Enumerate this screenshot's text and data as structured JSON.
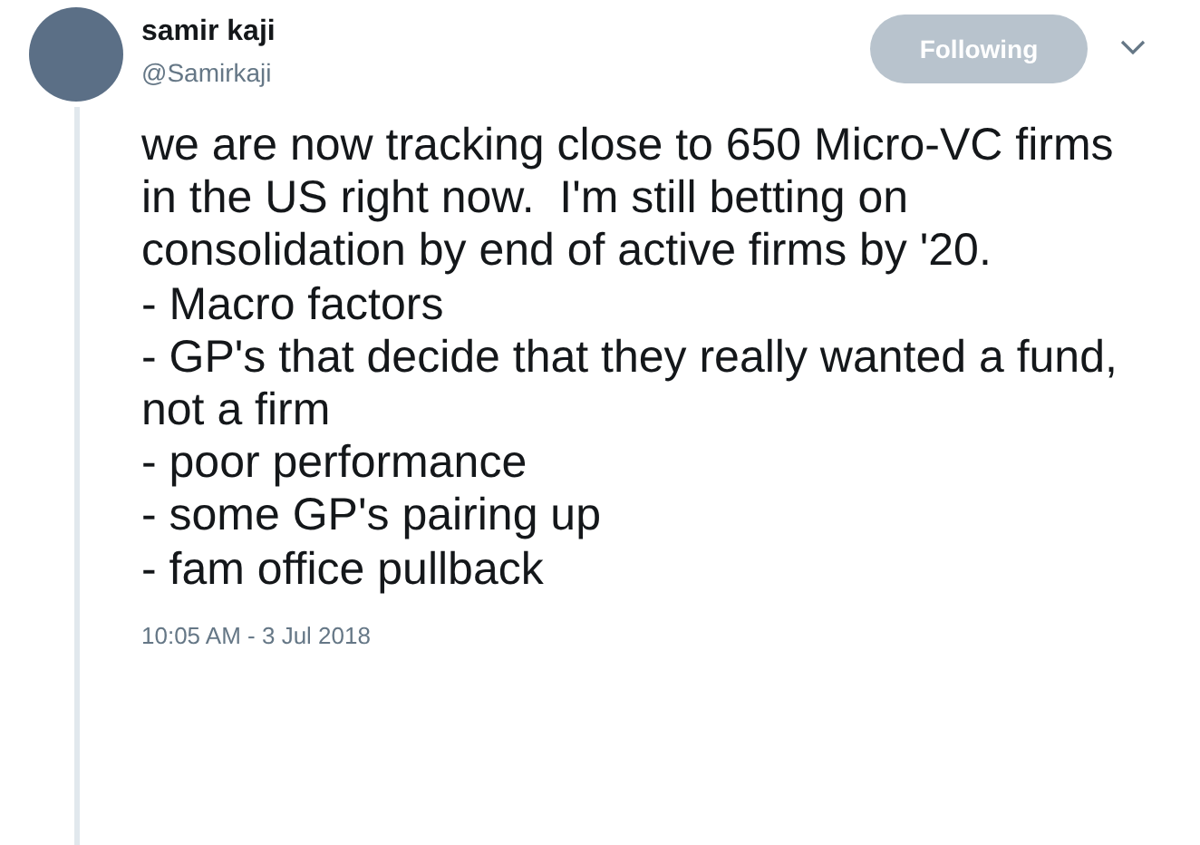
{
  "author": {
    "name": "samir kaji",
    "handle": "@Samirkaji"
  },
  "follow_button": {
    "label": "Following"
  },
  "tweet": {
    "text": "we are now tracking close to 650 Micro-VC firms in the US right now.  I'm still betting on consolidation by end of active firms by '20.\n- Macro factors\n- GP's that decide that they really wanted a fund, not a firm\n- poor performance\n- some GP's pairing up\n- fam office pullback",
    "timestamp": "10:05 AM - 3 Jul 2018"
  }
}
